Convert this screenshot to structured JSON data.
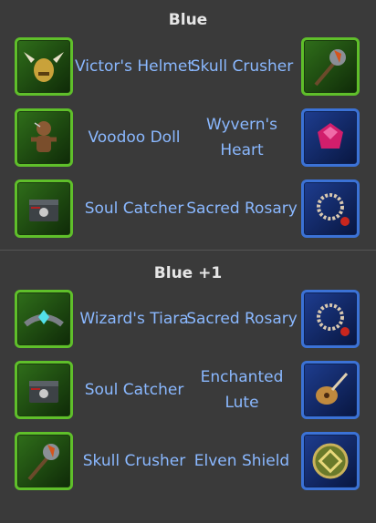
{
  "sections": [
    {
      "title": "Blue",
      "rows": [
        {
          "left": "Victor's Helmet",
          "right": "Skull Crusher"
        },
        {
          "left": "Voodoo Doll",
          "right": "Wyvern's Heart"
        },
        {
          "left": "Soul Catcher",
          "right": "Sacred Rosary"
        }
      ]
    },
    {
      "title": "Blue +1",
      "rows": [
        {
          "left": "Wizard's Tiara",
          "right": "Sacred Rosary"
        },
        {
          "left": "Soul Catcher",
          "right": "Enchanted Lute"
        },
        {
          "left": "Skull Crusher",
          "right": "Elven Shield"
        }
      ]
    }
  ],
  "icons": {
    "victors_helmet": "winged-helmet-icon",
    "skull_crusher": "mace-icon",
    "voodoo_doll": "voodoo-doll-icon",
    "wyverns_heart": "red-gem-icon",
    "soul_catcher": "skull-chest-icon",
    "sacred_rosary": "rosary-beads-icon",
    "wizards_tiara": "tiara-icon",
    "enchanted_lute": "lute-icon",
    "elven_shield": "shield-icon"
  },
  "colors": {
    "background": "#3a3a3a",
    "title_text": "#e6e6e6",
    "label_text": "#8ab8ff",
    "green_frame": "#5fbf2a",
    "blue_frame": "#3b72d6"
  }
}
